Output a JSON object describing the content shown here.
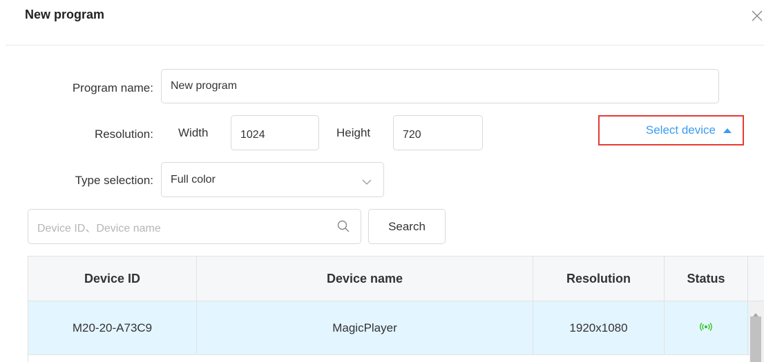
{
  "dialog": {
    "title": "New program"
  },
  "form": {
    "program_name_label": "Program name:",
    "program_name_value": "New program",
    "resolution_label": "Resolution:",
    "width_label": "Width",
    "width_value": "1024",
    "height_label": "Height",
    "height_value": "720",
    "type_label": "Type selection:",
    "type_value": "Full color",
    "select_device_label": "Select device"
  },
  "search": {
    "placeholder": "Device ID、Device name",
    "button_label": "Search"
  },
  "table": {
    "columns": [
      "Device ID",
      "Device name",
      "Resolution",
      "Status"
    ],
    "rows": [
      {
        "device_id": "M20-20-A73C9",
        "device_name": "MagicPlayer",
        "resolution": "1920x1080",
        "status": "online"
      }
    ]
  },
  "colors": {
    "accent": "#3a9cf0",
    "highlight_border": "#e53935",
    "selected_row": "#e3f5ff",
    "status_online": "#2ec41c"
  }
}
